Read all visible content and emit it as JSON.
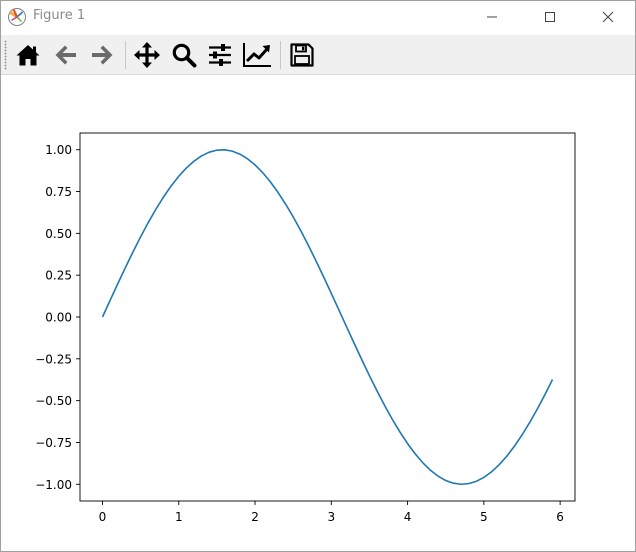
{
  "window": {
    "title": "Figure 1",
    "controls": {
      "minimize_icon": "minimize-icon",
      "maximize_icon": "maximize-icon",
      "close_icon": "close-icon"
    }
  },
  "toolbar": {
    "buttons": [
      {
        "name": "home",
        "icon": "home-icon"
      },
      {
        "name": "back",
        "icon": "arrow-left-icon"
      },
      {
        "name": "forward",
        "icon": "arrow-right-icon"
      },
      {
        "name": "pan",
        "icon": "move-arrows-icon"
      },
      {
        "name": "zoom",
        "icon": "magnifier-icon"
      },
      {
        "name": "configure-subplots",
        "icon": "sliders-icon"
      },
      {
        "name": "edit-axes",
        "icon": "line-chart-icon"
      },
      {
        "name": "save",
        "icon": "floppy-disk-icon"
      }
    ],
    "colors": {
      "background": "#f0f0f0",
      "icon": "#000000",
      "disabled_icon": "#6b6b6b"
    }
  },
  "chart_data": {
    "type": "line",
    "title": "",
    "xlabel": "",
    "ylabel": "",
    "xlim": [
      -0.295,
      6.195
    ],
    "ylim": [
      -1.1,
      1.1
    ],
    "xticks": [
      0,
      1,
      2,
      3,
      4,
      5,
      6
    ],
    "xtick_labels": [
      "0",
      "1",
      "2",
      "3",
      "4",
      "5",
      "6"
    ],
    "yticks": [
      -1.0,
      -0.75,
      -0.5,
      -0.25,
      0.0,
      0.25,
      0.5,
      0.75,
      1.0
    ],
    "ytick_labels": [
      "−1.00",
      "−0.75",
      "−0.50",
      "−0.25",
      "0.00",
      "0.25",
      "0.50",
      "0.75",
      "1.00"
    ],
    "grid": false,
    "series": [
      {
        "color": "#1f77b4",
        "x": [
          0.0,
          0.1,
          0.2,
          0.3,
          0.4,
          0.5,
          0.6,
          0.7,
          0.8,
          0.9,
          1.0,
          1.1,
          1.2,
          1.3,
          1.4,
          1.5,
          1.6,
          1.7,
          1.8,
          1.9,
          2.0,
          2.1,
          2.2,
          2.3,
          2.4,
          2.5,
          2.6,
          2.7,
          2.8,
          2.9,
          3.0,
          3.1,
          3.2,
          3.3,
          3.4,
          3.5,
          3.6,
          3.7,
          3.8,
          3.9,
          4.0,
          4.1,
          4.2,
          4.3,
          4.4,
          4.5,
          4.6,
          4.7,
          4.8,
          4.9,
          5.0,
          5.1,
          5.2,
          5.3,
          5.4,
          5.5,
          5.6,
          5.7,
          5.8,
          5.9
        ],
        "y": [
          0.0,
          0.0998,
          0.1987,
          0.2955,
          0.3894,
          0.4794,
          0.5646,
          0.6442,
          0.7174,
          0.7833,
          0.8415,
          0.8912,
          0.932,
          0.9636,
          0.9854,
          0.9975,
          0.9996,
          0.9917,
          0.9738,
          0.9463,
          0.9093,
          0.8632,
          0.8085,
          0.7457,
          0.6755,
          0.5985,
          0.5155,
          0.4274,
          0.335,
          0.2392,
          0.1411,
          0.0416,
          -0.0584,
          -0.1577,
          -0.2555,
          -0.3508,
          -0.4425,
          -0.5298,
          -0.6119,
          -0.6878,
          -0.7568,
          -0.8183,
          -0.8716,
          -0.9162,
          -0.9516,
          -0.9775,
          -0.9937,
          -0.9999,
          -0.9962,
          -0.9825,
          -0.9589,
          -0.9258,
          -0.8835,
          -0.8323,
          -0.7728,
          -0.7055,
          -0.6313,
          -0.5507,
          -0.4646,
          -0.3739
        ]
      }
    ]
  }
}
